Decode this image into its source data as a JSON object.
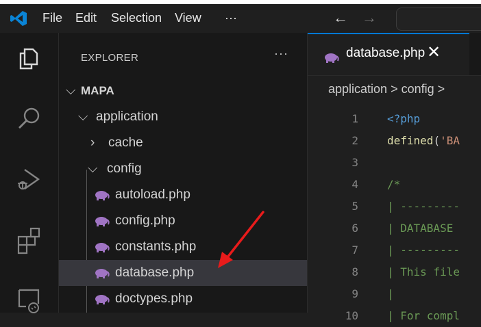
{
  "titlebar": {
    "menu": [
      "File",
      "Edit",
      "Selection",
      "View"
    ],
    "more": "···",
    "back": "←",
    "forward": "→"
  },
  "activity_bar": {
    "icons": [
      "explorer-icon",
      "search-icon",
      "run-debug-icon",
      "extensions-icon",
      "remote-explorer-icon"
    ]
  },
  "explorer": {
    "title": "EXPLORER",
    "more": "···",
    "tree": [
      {
        "label": "MAPA",
        "type": "folder-open",
        "depth": 0
      },
      {
        "label": "application",
        "type": "folder-open",
        "depth": 1
      },
      {
        "label": "cache",
        "type": "folder-closed",
        "depth": 2
      },
      {
        "label": "config",
        "type": "folder-open",
        "depth": 2
      },
      {
        "label": "autoload.php",
        "type": "file",
        "depth": 3
      },
      {
        "label": "config.php",
        "type": "file",
        "depth": 3
      },
      {
        "label": "constants.php",
        "type": "file",
        "depth": 3
      },
      {
        "label": "database.php",
        "type": "file",
        "depth": 3,
        "selected": true
      },
      {
        "label": "doctypes.php",
        "type": "file",
        "depth": 3
      }
    ]
  },
  "editor": {
    "tab": {
      "label": "database.php",
      "close": "✕"
    },
    "breadcrumb": "application > config >",
    "lines": [
      {
        "n": "1",
        "text": "<?php",
        "cls": "kw"
      },
      {
        "n": "2",
        "text": "defined('BA",
        "cls": "mixed"
      },
      {
        "n": "3",
        "text": "",
        "cls": "pl"
      },
      {
        "n": "4",
        "text": "/*",
        "cls": "cm"
      },
      {
        "n": "5",
        "text": "| ---------",
        "cls": "cm"
      },
      {
        "n": "6",
        "text": "| DATABASE ",
        "cls": "cm"
      },
      {
        "n": "7",
        "text": "| ---------",
        "cls": "cm"
      },
      {
        "n": "8",
        "text": "| This file",
        "cls": "cm"
      },
      {
        "n": "9",
        "text": "|",
        "cls": "cm"
      },
      {
        "n": "10",
        "text": "| For compl",
        "cls": "cm"
      }
    ]
  },
  "colors": {
    "accent": "#0078d4",
    "arrow": "#e81b1b",
    "php_icon": "#a074c4",
    "selection": "#37373d"
  }
}
